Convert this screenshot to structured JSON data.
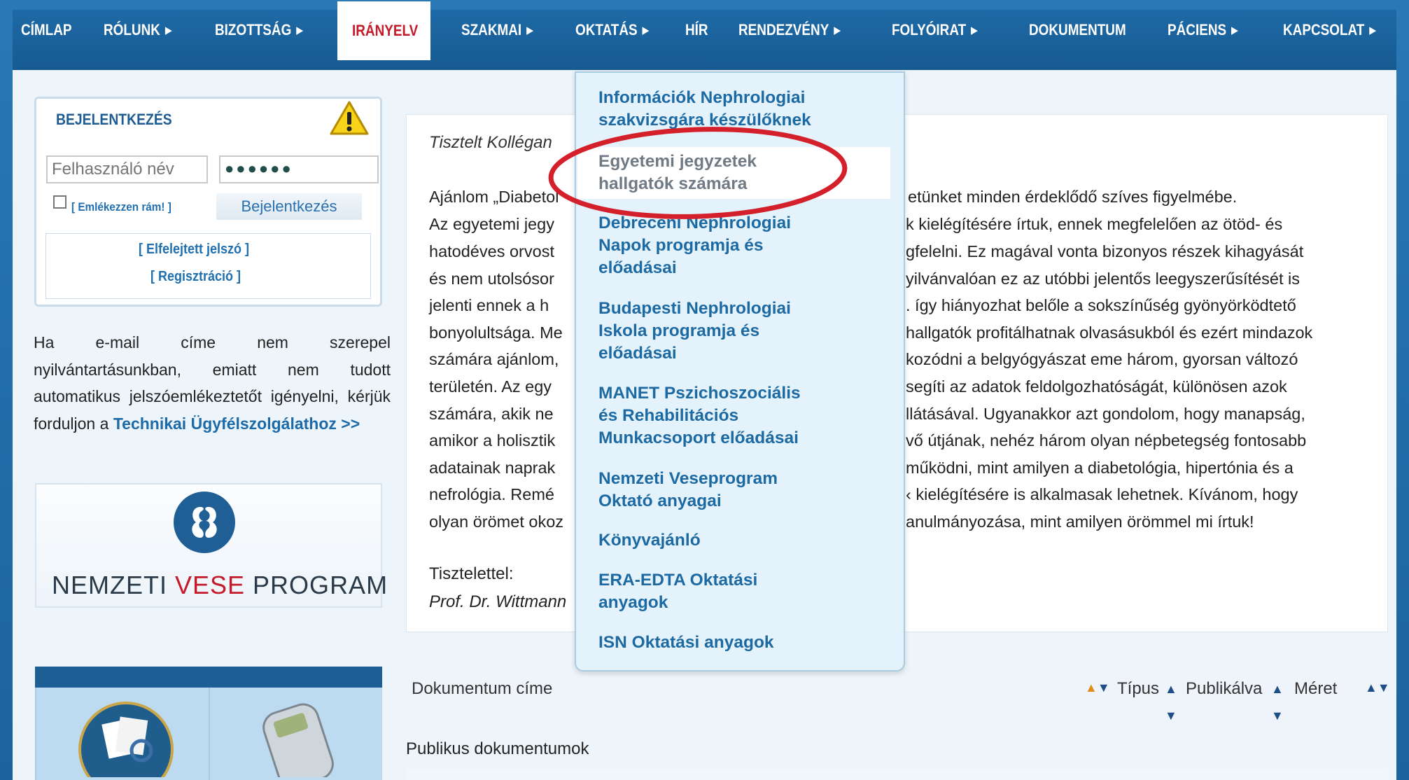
{
  "nav": {
    "items": [
      {
        "label": "CÍMLAP",
        "arrow": false
      },
      {
        "label": "RÓLUNK",
        "arrow": true
      },
      {
        "label": "BIZOTTSÁG",
        "arrow": true
      },
      {
        "label": "IRÁNYELV",
        "arrow": false,
        "active": true
      },
      {
        "label": "SZAKMAI",
        "arrow": true
      },
      {
        "label": "OKTATÁS",
        "arrow": true
      },
      {
        "label": "HÍR",
        "arrow": false
      },
      {
        "label": "RENDEZVÉNY",
        "arrow": true
      },
      {
        "label": "FOLYÓIRAT",
        "arrow": true
      },
      {
        "label": "DOKUMENTUM",
        "arrow": false
      },
      {
        "label": "PÁCIENS",
        "arrow": true
      },
      {
        "label": "KAPCSOLAT",
        "arrow": true
      }
    ],
    "arrow_glyph": "▶"
  },
  "login": {
    "title": "BEJELENTKEZÉS",
    "username_placeholder": "Felhasználó név",
    "password_value": "●●●●●●",
    "remember_label": "[ Emlékezzen rám! ]",
    "login_button": "Bejelentkezés",
    "forgot_link": "[ Elfelejtett jelszó ]",
    "register_link": "[ Regisztráció ]"
  },
  "info": {
    "text": "Ha e-mail címe nem szerepel nyilvántartásunkban, emiatt nem tudott automatikus jelszóemlékeztetőt igényelni, kérjük forduljon a ",
    "link": "Technikai Ügyfélszolgálathoz >>"
  },
  "nvp": {
    "word1": "NEMZETI ",
    "word2": "VESE",
    "word3": " PROGRAM"
  },
  "letter": {
    "greeting": "Tisztelt Kollégan",
    "lines_left": [
      "Ajánlom „Diabetol",
      "Az egyetemi jegy",
      "hatodéves orvost",
      "és nem utolsósor",
      "jelenti ennek a h",
      "bonyolultsága. Me",
      "számára ajánlom,",
      "területén. Az egy",
      "számára, akik ne",
      "amikor a holisztik",
      "adatainak naprak",
      "nefrológia. Remé",
      "olyan örömet okoz"
    ],
    "lines_right": [
      "etünket minden érdeklődő szíves figyelmébe.",
      "k kielégítésére írtuk, ennek megfelelően az ötöd- és",
      "gfelelni. Ez magával vonta bizonyos részek kihagyását",
      "yilvánvalóan ez az utóbbi jelentős leegyszerűsítését is",
      ". így hiányozhat belőle a sokszínűség gyönyörködtető",
      "hallgatók profitálhatnak olvasásukból és ezért mindazok",
      "kozódni a belgyógyászat eme három, gyorsan változó",
      " segíti az adatok feldolgozhatóságát, különösen azok",
      "llátásával. Ugyanakkor azt gondolom, hogy manapság,",
      "vő útjának, nehéz három olyan népbetegség fontosabb",
      " működni, mint amilyen a diabetológia, hipertónia és a",
      "‹ kielégítésére is alkalmasak lehetnek. Kívánom, hogy",
      "anulmányozása, mint amilyen örömmel mi írtuk!"
    ],
    "regards": "Tisztelettel:",
    "signature": "Prof. Dr. Wittmann"
  },
  "table": {
    "col_title": "Dokumentum címe",
    "col_type": "Típus",
    "col_published": "Publikálva",
    "col_size": "Méret",
    "public_docs": "Publikus dokumentumok"
  },
  "dropdown": {
    "items": [
      {
        "line1": "Információk Nephrologiai",
        "line2": "szakvizsgára készülőknek"
      },
      {
        "line1": "Egyetemi jegyzetek",
        "line2": "hallgatók számára",
        "highlighted": true
      },
      {
        "line1": "Debreceni Nephrologiai",
        "line2": "Napok programja és",
        "line3": "előadásai"
      },
      {
        "line1": "Budapesti Nephrologiai",
        "line2": "Iskola programja és",
        "line3": "előadásai"
      },
      {
        "line1": "MANET Pszichoszociális",
        "line2": "és Rehabilitációs",
        "line3": "Munkacsoport előadásai"
      },
      {
        "line1": "Nemzeti Veseprogram",
        "line2": "Oktató anyagai"
      },
      {
        "line1": "Könyvajánló"
      },
      {
        "line1": "ERA-EDTA Oktatási",
        "line2": "anyagok"
      },
      {
        "line1": "ISN Oktatási anyagok"
      }
    ]
  },
  "colors": {
    "nav_bg": "#1a5f96",
    "active_text": "#c41a2a",
    "link": "#1d6aa3",
    "dropdown_bg": "#e3f2fb",
    "annotation_red": "#d4202a"
  }
}
